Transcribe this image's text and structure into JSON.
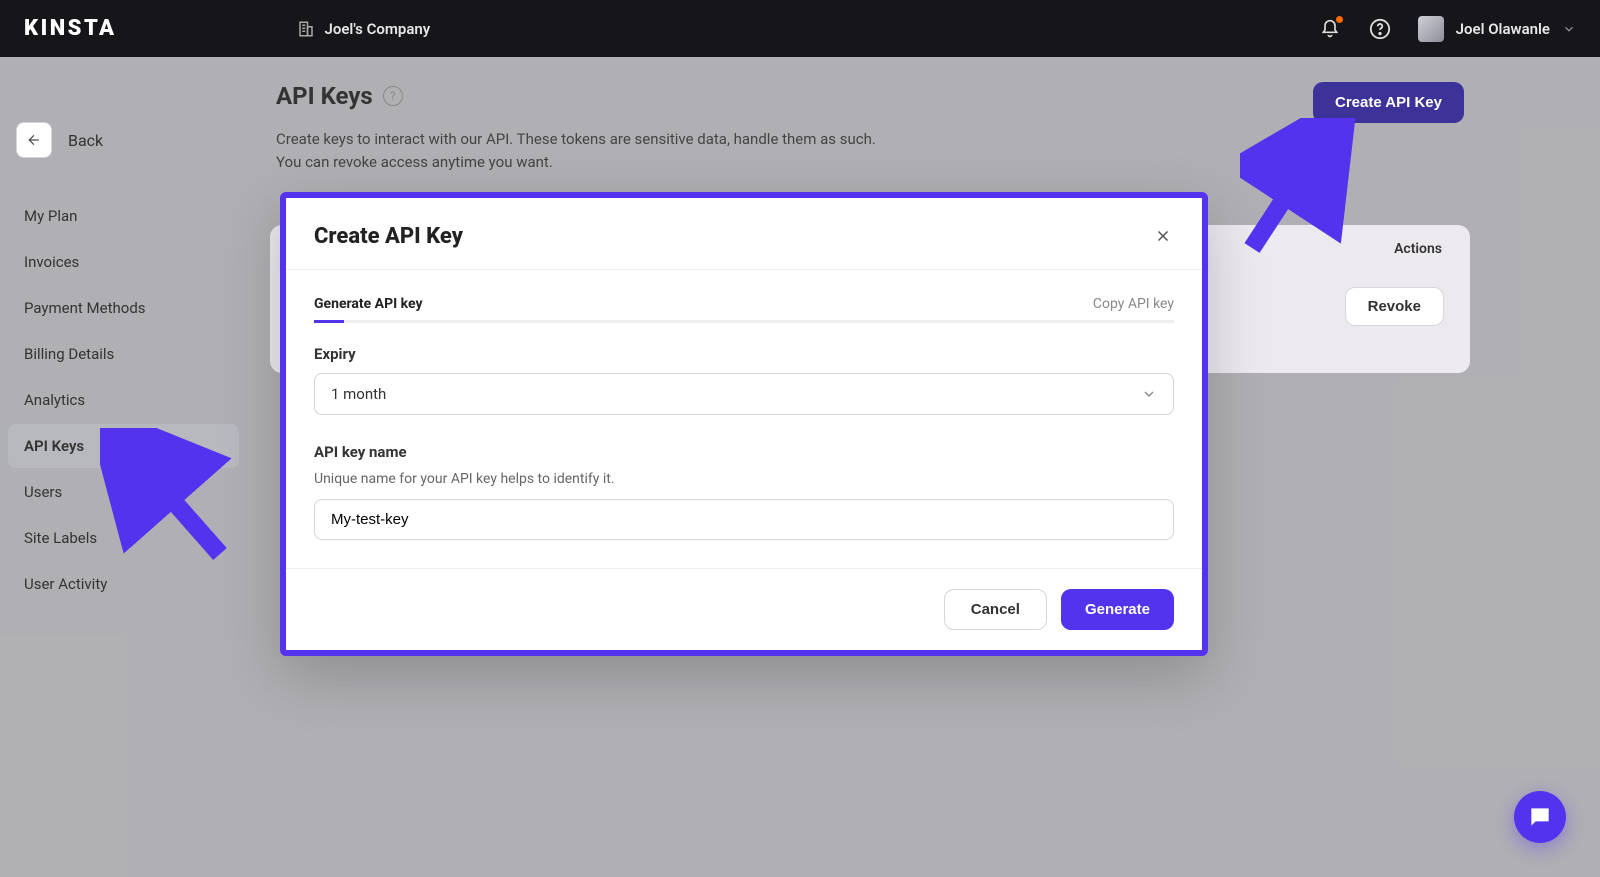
{
  "brand": "KINSTA",
  "company_name": "Joel's Company",
  "user_name": "Joel Olawanle",
  "back_label": "Back",
  "sidebar": {
    "items": [
      {
        "label": "My Plan",
        "active": false
      },
      {
        "label": "Invoices",
        "active": false
      },
      {
        "label": "Payment Methods",
        "active": false
      },
      {
        "label": "Billing Details",
        "active": false
      },
      {
        "label": "Analytics",
        "active": false
      },
      {
        "label": "API Keys",
        "active": true
      },
      {
        "label": "Users",
        "active": false
      },
      {
        "label": "Site Labels",
        "active": false
      },
      {
        "label": "User Activity",
        "active": false
      }
    ]
  },
  "page": {
    "title": "API Keys",
    "desc_line1": "Create keys to interact with our API. These tokens are sensitive data, handle them as such.",
    "desc_line2": "You can revoke access anytime you want.",
    "create_button": "Create API Key"
  },
  "table": {
    "actions_header": "Actions",
    "revoke_label": "Revoke"
  },
  "modal": {
    "title": "Create API Key",
    "step1": "Generate API key",
    "step2": "Copy API key",
    "expiry_label": "Expiry",
    "expiry_value": "1 month",
    "name_label": "API key name",
    "name_hint": "Unique name for your API key helps to identify it.",
    "name_value": "My-test-key",
    "cancel": "Cancel",
    "generate": "Generate"
  },
  "colors": {
    "accent": "#5333ed",
    "accent_dark": "#3d3297",
    "topbar": "#15151a"
  }
}
